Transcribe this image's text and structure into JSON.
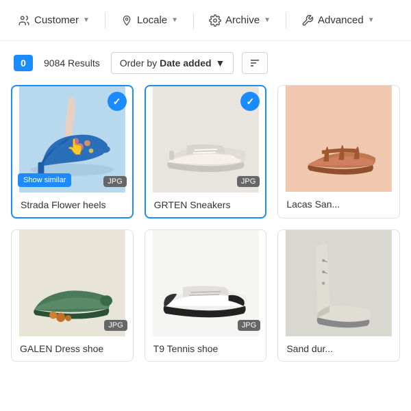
{
  "nav": {
    "items": [
      {
        "id": "customer",
        "label": "Customer",
        "icon": "people"
      },
      {
        "id": "locale",
        "label": "Locale",
        "icon": "location"
      },
      {
        "id": "archive",
        "label": "Archive",
        "icon": "gear"
      },
      {
        "id": "advanced",
        "label": "Advanced",
        "icon": "wrench"
      }
    ]
  },
  "toolbar": {
    "badge": "0",
    "results": "9084 Results",
    "order_label": "Order by",
    "order_value": "Date added",
    "sort_icon": "≡"
  },
  "cards": [
    {
      "id": "card-1",
      "title": "Strada Flower heels",
      "format": "JPG",
      "selected": true,
      "show_similar": true,
      "bg": "card-bg-1",
      "emoji": "👠"
    },
    {
      "id": "card-2",
      "title": "GRTEN Sneakers",
      "format": "JPG",
      "selected": true,
      "show_similar": false,
      "bg": "card-bg-2",
      "emoji": "👟"
    },
    {
      "id": "card-3",
      "title": "Lacas San...",
      "format": "",
      "selected": false,
      "show_similar": false,
      "bg": "card-bg-3",
      "emoji": "👡"
    },
    {
      "id": "card-4",
      "title": "GALEN Dress shoe",
      "format": "JPG",
      "selected": false,
      "show_similar": false,
      "bg": "card-bg-4",
      "emoji": "👞"
    },
    {
      "id": "card-5",
      "title": "T9 Tennis shoe",
      "format": "JPG",
      "selected": false,
      "show_similar": false,
      "bg": "card-bg-5",
      "emoji": "👟"
    },
    {
      "id": "card-6",
      "title": "Sand dur...",
      "format": "",
      "selected": false,
      "show_similar": false,
      "bg": "card-bg-6",
      "emoji": "👢"
    }
  ],
  "labels": {
    "show_similar": "Show similar",
    "order_by_prefix": "Order by "
  }
}
